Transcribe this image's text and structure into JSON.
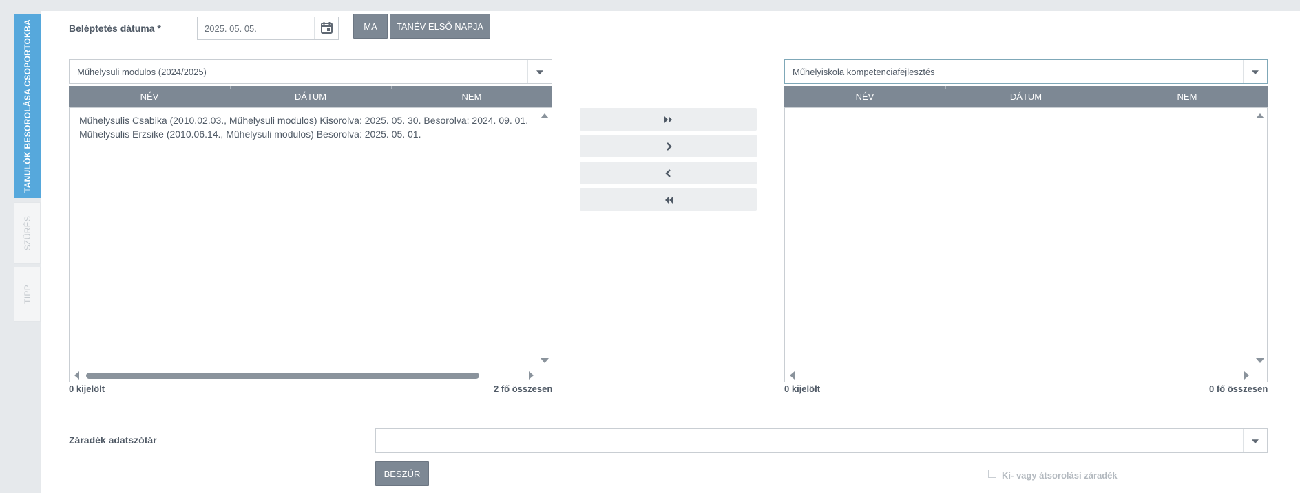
{
  "side_tabs": {
    "active": "TANULÓK BESOROLÁSA CSOPORTOKBA",
    "filter": "SZŰRÉS",
    "tip": "TIPP"
  },
  "form": {
    "date_label": "Beléptetés dátuma *",
    "date_value": "2025. 05. 05.",
    "today_button": "MA",
    "first_day_button": "TANÉV ELSŐ NAPJA"
  },
  "left_list": {
    "selector_value": "Műhelysuli modulos (2024/2025)",
    "columns": [
      "NÉV",
      "DÁTUM",
      "NEM"
    ],
    "rows": [
      "Műhelysulis Csabika (2010.02.03., Műhelysuli modulos) Kisorolva: 2025. 05. 30. Besorolva: 2024. 09. 01.",
      "Műhelysulis Erzsike (2010.06.14., Műhelysuli modulos) Besorolva: 2025. 05. 01."
    ],
    "selected_count": "0 kijelölt",
    "total_count": "2 fő összesen",
    "hscroll_fraction": 0.9
  },
  "right_list": {
    "selector_value": "Műhelyiskola kompetenciafejlesztés",
    "columns": [
      "NÉV",
      "DÁTUM",
      "NEM"
    ],
    "rows": [],
    "selected_count": "0 kijelölt",
    "total_count": "0 fő összesen"
  },
  "transfer_buttons": {
    "move_all_right": "double-chevron-right-icon",
    "move_right": "chevron-right-icon",
    "move_left": "chevron-left-icon",
    "move_all_left": "double-chevron-left-icon"
  },
  "clause": {
    "label": "Záradék adatszótár",
    "value": "",
    "insert_button": "BESZÚR",
    "checkbox_label": "Ki- vagy átsorolási záradék",
    "checkbox_checked": false
  },
  "colors": {
    "accent_tab": "#56a8dc",
    "header_gray": "#7d8894",
    "page_bg": "#e6e9ec"
  }
}
